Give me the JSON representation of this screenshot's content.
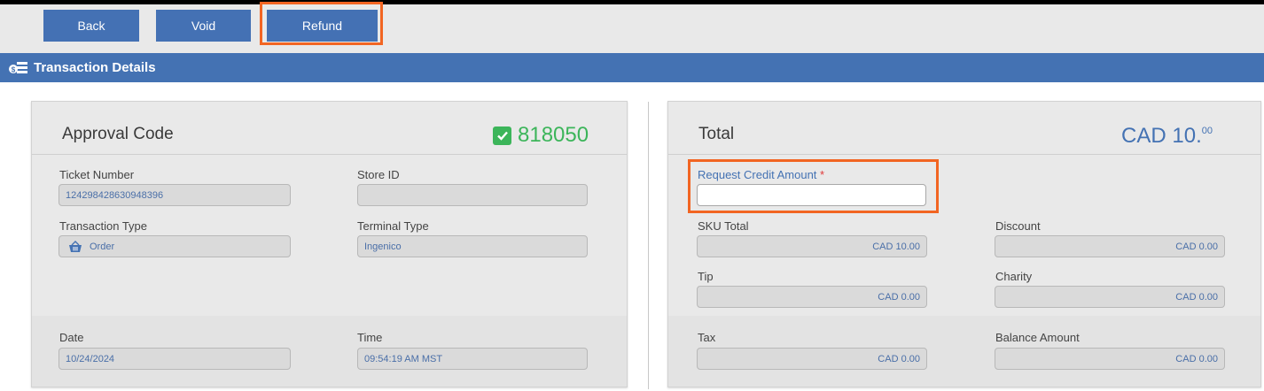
{
  "toolbar": {
    "back": "Back",
    "void": "Void",
    "refund": "Refund"
  },
  "header": {
    "title": "Transaction Details"
  },
  "left": {
    "approval_label": "Approval Code",
    "approval_code": "818050",
    "ticket_number_label": "Ticket Number",
    "ticket_number": "124298428630948396",
    "store_id_label": "Store ID",
    "store_id": "",
    "transaction_type_label": "Transaction Type",
    "transaction_type": "Order",
    "terminal_type_label": "Terminal Type",
    "terminal_type": "Ingenico",
    "date_label": "Date",
    "date": "10/24/2024",
    "time_label": "Time",
    "time": "09:54:19 AM MST"
  },
  "right": {
    "total_label": "Total",
    "total_currency": "CAD 10.",
    "total_cents": "00",
    "request_credit_label": "Request Credit Amount",
    "required_mark": "*",
    "request_credit_value": "",
    "sku_total_label": "SKU Total",
    "sku_total": "CAD 10.00",
    "discount_label": "Discount",
    "discount": "CAD 0.00",
    "tip_label": "Tip",
    "tip": "CAD 0.00",
    "charity_label": "Charity",
    "charity": "CAD 0.00",
    "tax_label": "Tax",
    "tax": "CAD 0.00",
    "balance_label": "Balance Amount",
    "balance": "CAD 0.00"
  },
  "colors": {
    "accent": "#4472b3",
    "approved": "#3cb55a",
    "highlight": "#f26522",
    "required": "#e03a3a"
  },
  "icons": {
    "header": "money-stack-icon",
    "approved": "checkbox-checked-icon",
    "order": "basket-icon"
  }
}
